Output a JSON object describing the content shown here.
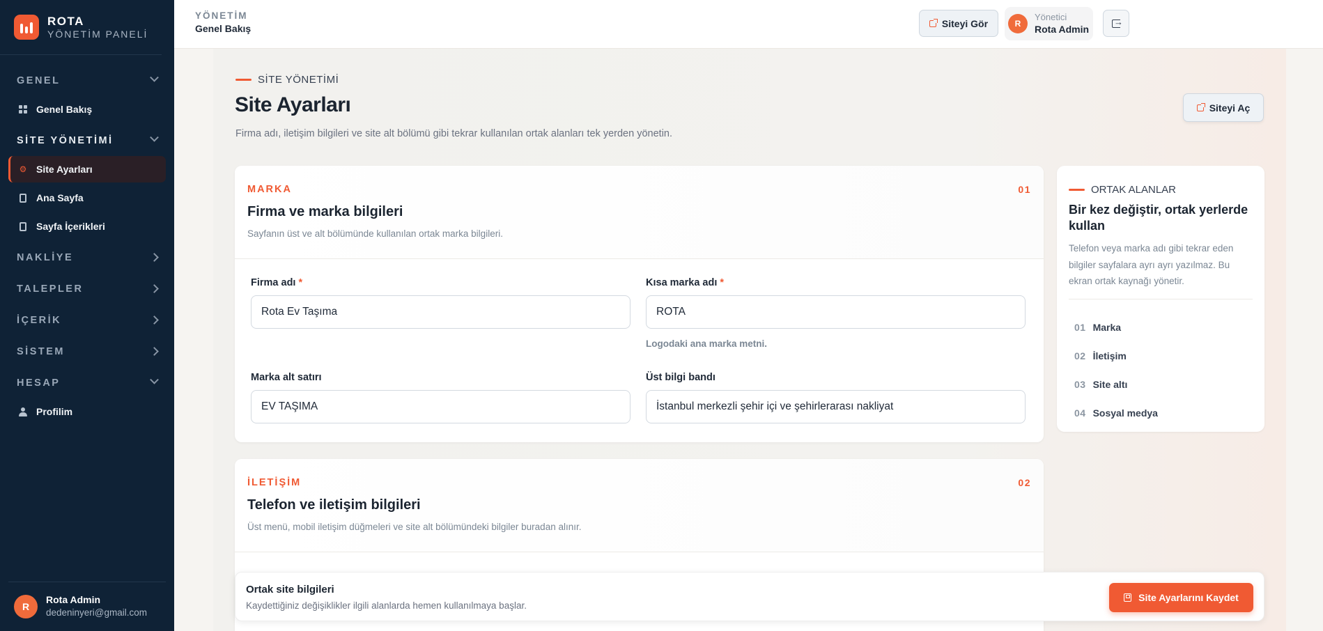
{
  "sidebar": {
    "brand_title": "ROTA",
    "brand_sub": "YÖNETİM PANELİ",
    "sections": {
      "genel": "GENEL",
      "site_yonetimi": "SİTE YÖNETİMİ",
      "nakliye": "NAKLİYE",
      "talepler": "TALEPLER",
      "icerik": "İÇERİK",
      "sistem": "SİSTEM",
      "hesap": "HESAP"
    },
    "items": {
      "genel_bakis": "Genel Bakış",
      "site_ayarlari": "Site Ayarları",
      "ana_sayfa": "Ana Sayfa",
      "sayfa_icerikleri": "Sayfa İçerikleri",
      "profilim": "Profilim"
    },
    "footer": {
      "avatar_letter": "R",
      "name": "Rota Admin",
      "email": "dedeninyeri@gmail.com"
    }
  },
  "topbar": {
    "crumb_top": "YÖNETİM",
    "crumb_main": "Genel Bakış",
    "view_site": "Siteyi Gör",
    "user_avatar": "R",
    "user_role": "Yönetici",
    "user_name": "Rota Admin"
  },
  "page": {
    "eyebrow": "SİTE YÖNETİMİ",
    "title": "Site Ayarları",
    "description": "Firma adı, iletişim bilgileri ve site alt bölümü gibi tekrar kullanılan ortak alanları tek yerden yönetin.",
    "open_site": "Siteyi Aç"
  },
  "brand_card": {
    "kicker": "MARKA",
    "number": "01",
    "title": "Firma ve marka bilgileri",
    "description": "Sayfanın üst ve alt bölümünde kullanılan ortak marka bilgileri.",
    "fields": {
      "firma_adi": {
        "label": "Firma adı",
        "required": "*",
        "value": "Rota Ev Taşıma"
      },
      "kisa_marka": {
        "label": "Kısa marka adı",
        "required": "*",
        "value": "ROTA",
        "help": "Logodaki ana marka metni."
      },
      "alt_satir": {
        "label": "Marka alt satırı",
        "value": "EV TAŞIMA"
      },
      "ust_bant": {
        "label": "Üst bilgi bandı",
        "value": "İstanbul merkezli şehir içi ve şehirlerarası nakliyat"
      }
    }
  },
  "contact_card": {
    "kicker": "İLETİŞİM",
    "number": "02",
    "title": "Telefon ve iletişim bilgileri",
    "description": "Üst menü, mobil iletişim düğmeleri ve site alt bölümündeki bilgiler buradan alınır."
  },
  "side_panel": {
    "eyebrow": "ORTAK ALANLAR",
    "title": "Bir kez değiştir, ortak yerlerde kullan",
    "description": "Telefon veya marka adı gibi tekrar eden bilgiler sayfalara ayrı ayrı yazılmaz. Bu ekran ortak kaynağı yönetir.",
    "items": [
      {
        "num": "01",
        "label": "Marka"
      },
      {
        "num": "02",
        "label": "İletişim"
      },
      {
        "num": "03",
        "label": "Site altı"
      },
      {
        "num": "04",
        "label": "Sosyal medya"
      }
    ]
  },
  "savebar": {
    "title": "Ortak site bilgileri",
    "description": "Kaydettiğiniz değişiklikler ilgili alanlarda hemen kullanılmaya başlar.",
    "save_label": "Site Ayarlarını Kaydet"
  },
  "colors": {
    "accent": "#f05a33",
    "sidebar_bg": "#0f2236"
  }
}
